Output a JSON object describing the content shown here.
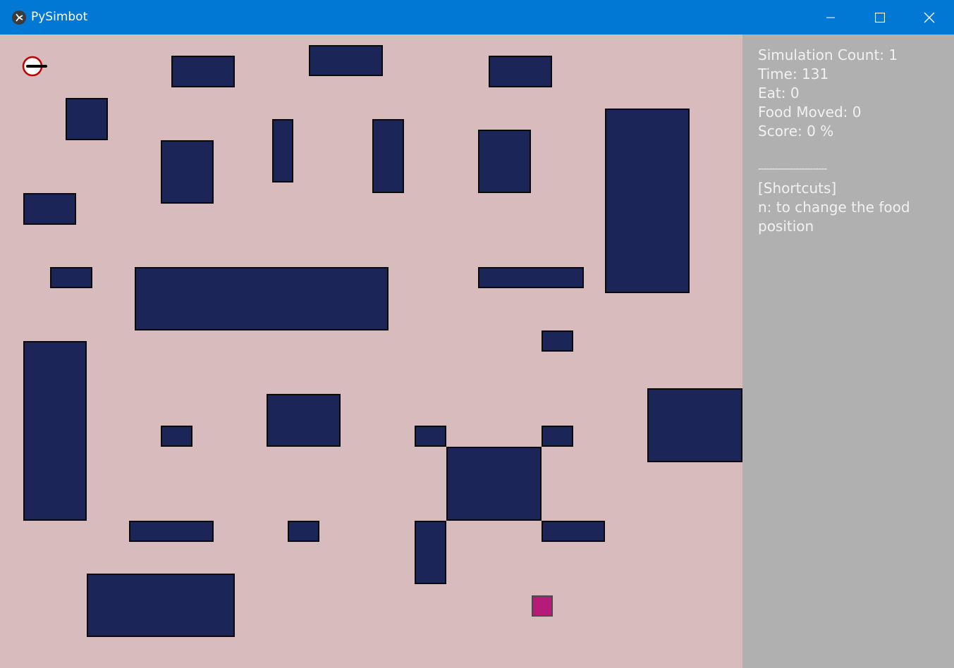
{
  "window": {
    "title": "PySimbot",
    "controls": {
      "minimize": "minimize-icon",
      "maximize": "maximize-icon",
      "close": "close-icon"
    }
  },
  "colors": {
    "titlebar": "#0078d4",
    "arena_bg": "#d7bbbd",
    "obstacle": "#1b2557",
    "food": "#b61b7a",
    "panel_bg": "#b0b0b0",
    "robot_outline": "#c00000"
  },
  "status": {
    "simulation_count": "Simulation Count: 1",
    "time": "Time: 131",
    "eat": "Eat: 0",
    "food_moved": "Food Moved: 0",
    "score": "Score: 0 %"
  },
  "divider": "------------------------",
  "shortcuts": {
    "header": "[Shortcuts]",
    "items": [
      "n: to change the food position"
    ]
  },
  "icons": {
    "robot": "robot-icon",
    "food": "food-icon"
  }
}
